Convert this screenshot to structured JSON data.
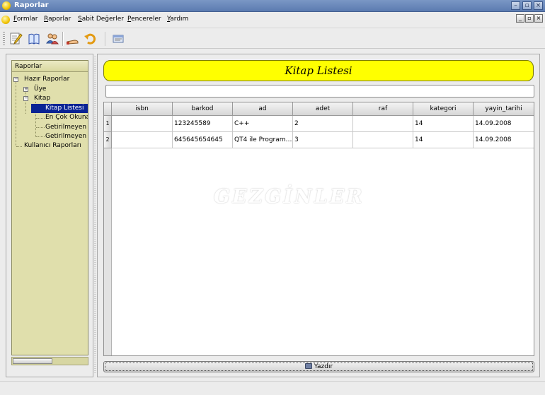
{
  "window": {
    "title": "Raporlar"
  },
  "menubar": {
    "items": [
      "Formlar",
      "Raporlar",
      "Sabit Değerler",
      "Pencereler",
      "Yardım"
    ]
  },
  "tree": {
    "header": "Raporlar",
    "items": [
      {
        "label": "Hazır Raporlar",
        "level": 0,
        "expander": "−"
      },
      {
        "label": "Üye",
        "level": 1,
        "expander": "+"
      },
      {
        "label": "Kitap",
        "level": 1,
        "expander": "−"
      },
      {
        "label": "Kitap Listesi",
        "level": 2,
        "selected": true
      },
      {
        "label": "En Çok Okunan",
        "level": 2
      },
      {
        "label": "Getirilmeyen K",
        "level": 2
      },
      {
        "label": "Getirilmeyen G",
        "level": 2
      },
      {
        "label": "Kullanıcı Raporları",
        "level": 0
      }
    ]
  },
  "report": {
    "title": "Kitap Listesi",
    "filter_value": "",
    "columns": [
      "isbn",
      "barkod",
      "ad",
      "adet",
      "raf",
      "kategori",
      "yayin_tarihi"
    ],
    "rows": [
      {
        "num": "1",
        "cells": [
          "",
          "123245589",
          "C++",
          "2",
          "",
          "14",
          "14.09.2008"
        ]
      },
      {
        "num": "2",
        "cells": [
          "",
          "645645654645",
          "QT4 ile Programl...",
          "3",
          "",
          "14",
          "14.09.2008"
        ]
      }
    ],
    "watermark": "GEZGİNLER",
    "print_label": "Yazdır"
  },
  "colors": {
    "banner": "#ffff00",
    "tree_bg": "#e0dfac",
    "selection": "#0a2494",
    "titlebar": "#5b7bb0"
  },
  "toolbar": {
    "icons": [
      "edit-form-icon",
      "book-icon",
      "users-icon",
      "hand-icon",
      "undo-arrow-icon",
      "window-icon"
    ]
  }
}
